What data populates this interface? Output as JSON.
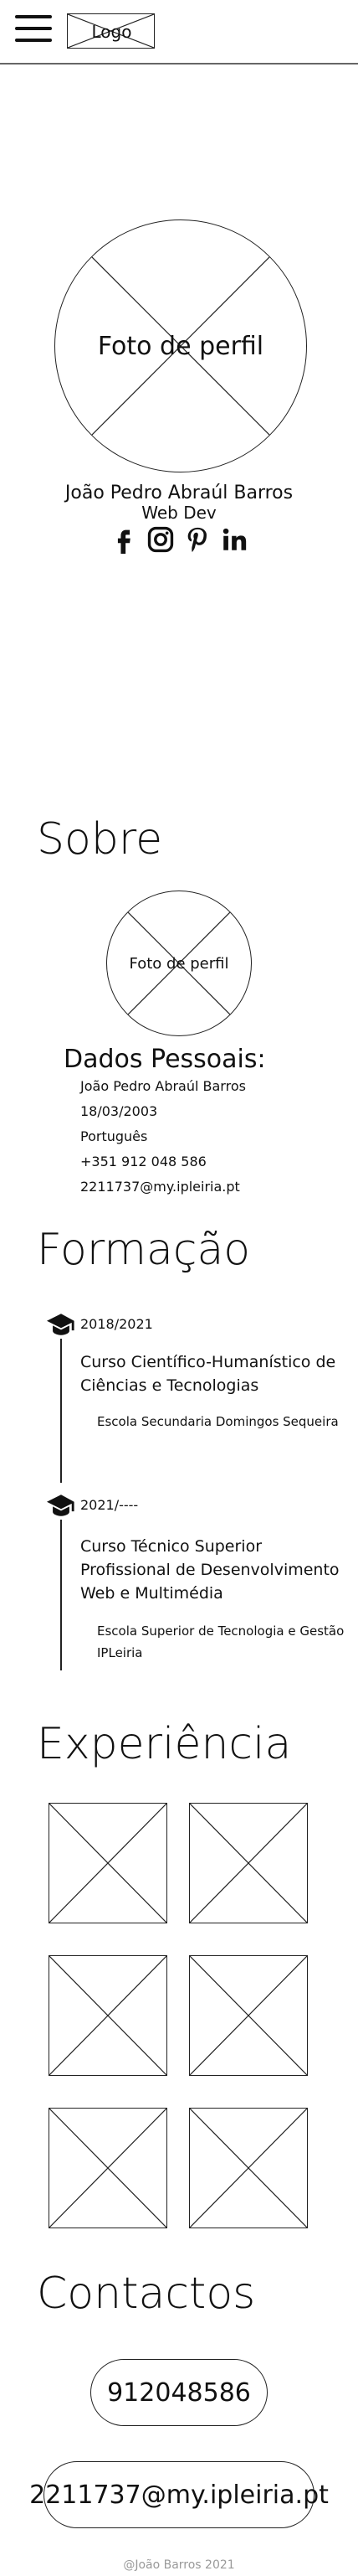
{
  "header": {
    "logo_label": "Logo",
    "menu_icon": "hamburger-menu-icon"
  },
  "hero": {
    "photo_label": "Foto de perfil",
    "name": "João Pedro Abraúl Barros",
    "role": "Web Dev",
    "socials": [
      "facebook-icon",
      "instagram-icon",
      "pinterest-icon",
      "linkedin-icon"
    ]
  },
  "about": {
    "title": "Sobre",
    "photo_label": "Foto de perfil",
    "personal_title": "Dados Pessoais:",
    "items": [
      "João Pedro Abraúl Barros",
      "18/03/2003",
      "Português",
      "+351 912 048 586",
      "2211737@my.ipleiria.pt"
    ]
  },
  "education": {
    "title": "Formação",
    "entries": [
      {
        "date": "2018/2021",
        "course": "Curso Científico-Humanístico de Ciências e Tecnologias",
        "school": "Escola Secundaria Domingos Sequeira"
      },
      {
        "date": "2021/----",
        "course": "Curso Técnico Superior Profissional de Desenvolvimento Web e Multimédia",
        "school": "Escola Superior de Tecnologia e Gestão IPLeiria"
      }
    ]
  },
  "experience": {
    "title": "Experiência"
  },
  "contacts": {
    "title": "Contactos",
    "phone": "912048586",
    "email": "2211737@my.ipleiria.pt"
  },
  "footer": {
    "text": "@João Barros 2021"
  }
}
